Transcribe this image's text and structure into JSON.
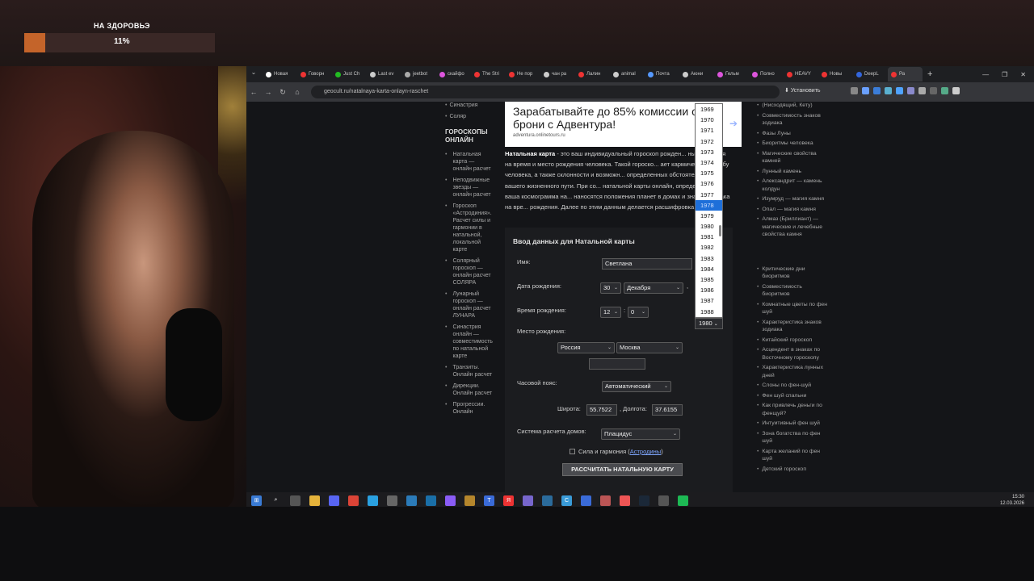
{
  "overlay": {
    "title": "НА ЗДОРОВЬЭ",
    "percent_label": "11%",
    "progress": 0.11
  },
  "tabs": [
    {
      "label": "Новая",
      "color": "#ffffff"
    },
    {
      "label": "Говорн",
      "color": "#e33"
    },
    {
      "label": "Just Ch",
      "color": "#2b2"
    },
    {
      "label": "Last ev",
      "color": "#ccc"
    },
    {
      "label": "jeetbot",
      "color": "#aaa"
    },
    {
      "label": "скайфо",
      "color": "#d5d"
    },
    {
      "label": "The Stri",
      "color": "#e33"
    },
    {
      "label": "Не пор",
      "color": "#e33"
    },
    {
      "label": "чан ра",
      "color": "#ccc"
    },
    {
      "label": "Лалин",
      "color": "#e33"
    },
    {
      "label": "animal",
      "color": "#ccc"
    },
    {
      "label": "Почта",
      "color": "#59f"
    },
    {
      "label": "Аюни",
      "color": "#ccc"
    },
    {
      "label": "Гельм",
      "color": "#d5d"
    },
    {
      "label": "Полно",
      "color": "#d5d"
    },
    {
      "label": "HEAVY",
      "color": "#e33"
    },
    {
      "label": "Новы",
      "color": "#e33"
    },
    {
      "label": "DeepL",
      "color": "#36d"
    },
    {
      "label": "Ра",
      "color": "#e33"
    }
  ],
  "browser": {
    "url": "geocult.ru/natalnaya-karta-onlayn-raschet",
    "install_label": "Установить"
  },
  "left_nav": {
    "top_items": [
      "Синастрия",
      "Соляр"
    ],
    "heading": "ГОРОСКОПЫ ОНЛАЙН",
    "items": [
      "Натальная карта — онлайн расчет",
      "Неподвижные звезды — онлайн расчет",
      "Гороскоп «Астродиния». Расчет силы и гармонии в натальной, локальной карте",
      "Солярный гороскоп — онлайн расчет СОЛЯРА",
      "Лунарный гороскоп — онлайн расчет ЛУНАРА",
      "Синастрия онлайн — совместимость по натальной карте",
      "Транзиты. Онлайн расчет",
      "Дирекции. Онлайн расчет",
      "Прогрессии. Онлайн"
    ]
  },
  "ad": {
    "title": "Зарабатывайте до 85% комиссии от брони с Адвентура!",
    "source": "adventura.onlinetours.ru"
  },
  "article": {
    "bold_start": "Натальная карта",
    "text": " - это ваш индивидуальный гороскоп рожден... ный строится на время и место рождения человека. Такой гороско... ает кармическую судьбу человека, а также склонности и возможн... определенных обстоятельств вашего жизненного пути. При со... натальной карты онлайн, определяется ваша космограмма на... наносятся положения планет в домах и знаках зодиака на вре... рождения. Далее по этим данным делается расшифровка гор..."
  },
  "form": {
    "title": "Ввод данных для Натальной карты",
    "name_label": "Имя:",
    "name_value": "Светлана",
    "birthdate_label": "Дата рождения:",
    "day": "30",
    "month": "Декабря",
    "year": "1980",
    "comma": ",",
    "birthtime_label": "Время рождения:",
    "hour": "12",
    "time_sep": ":",
    "minute": "0",
    "place_label": "Место рождения:",
    "country": "Россия",
    "city": "Москва",
    "timezone_label": "Часовой пояс:",
    "timezone": "Автоматический",
    "lat_label": "Широта:",
    "lat": "55.7522",
    "lon_label": ", Долгота:",
    "lon": "37.6155",
    "houses_label": "Система расчета домов:",
    "houses": "Плацидус",
    "checkbox_label": "Сила и гармония (",
    "checkbox_link": "Астродины",
    "checkbox_tail": ")",
    "submit": "РАССЧИТАТЬ НАТАЛЬНУЮ КАРТУ"
  },
  "year_dropdown": {
    "items": [
      "1969",
      "1970",
      "1971",
      "1972",
      "1973",
      "1974",
      "1975",
      "1976",
      "1977",
      "1978",
      "1979",
      "1980",
      "1981",
      "1982",
      "1983",
      "1984",
      "1985",
      "1986",
      "1987",
      "1988"
    ],
    "highlighted": "1978"
  },
  "right_nav": {
    "group1": [
      "(Нисходящий, Кету)",
      "Совместимость знаков зодиака",
      "Фазы Луны",
      "Биоритмы человека",
      "Магические свойства камней",
      "Лунный камень",
      "Александрит — камень колдун",
      "Изумруд — магия камня",
      "Опал — магия камня",
      "Алмаз (Бриллиант) — магические и лечебные свойства камня"
    ],
    "group2": [
      "Критические дни биоритмов",
      "Совместимость биоритмов",
      "Комнатные цветы по фен шуй",
      "Характеристика знаков зодиака",
      "Китайский гороскоп",
      "Асцендент в знаках по Восточному гороскопу",
      "Характеристика лунных дней",
      "Слоны по фен-шуй",
      "Фен шуй спальни",
      "Как привлечь деньги по фенщуй?",
      "Интуитивный фен шуй",
      "Зона богатства по фен шуй",
      "Карта желаний по фен шуй",
      "Детский гороскоп"
    ]
  },
  "taskbar": {
    "time": "15:30",
    "date": "12.03.2026"
  }
}
